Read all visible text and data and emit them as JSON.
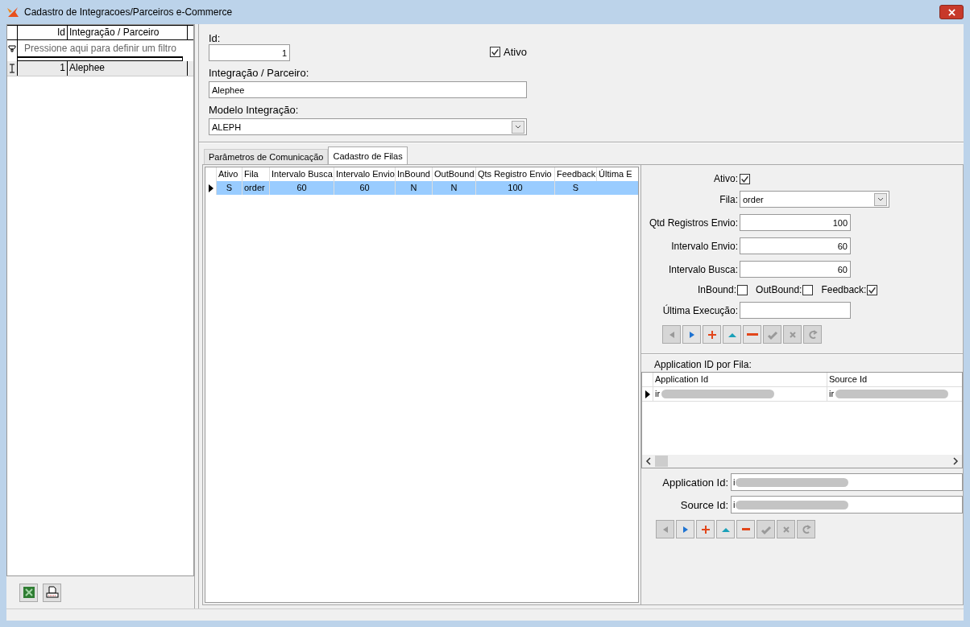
{
  "window": {
    "title": "Cadastro de Integracoes/Parceiros e-Commerce"
  },
  "left_grid": {
    "columns": [
      "Id",
      "Integração / Parceiro"
    ],
    "filter_hint": "Pressione aqui para definir um filtro",
    "rows": [
      {
        "id": "1",
        "name": "Alephee",
        "selected": true
      }
    ]
  },
  "left_toolbar": [
    {
      "kind": "excel"
    },
    {
      "kind": "print"
    }
  ],
  "form": {
    "id_label": "Id:",
    "id_value": "1",
    "ativo": {
      "label": "Ativo",
      "checked": true
    },
    "partner_label": "Integração / Parceiro:",
    "partner_value": "Alephee",
    "model_label": "Modelo Integração:",
    "model_value": "ALEPH"
  },
  "tabs": [
    {
      "label": "Parâmetros de Comunicação",
      "selected": false
    },
    {
      "label": "Cadastro de Filas",
      "selected": true
    }
  ],
  "queue_grid": {
    "columns": [
      "Ativo",
      "Fila",
      "Intervalo Busca",
      "Intervalo Envio",
      "InBound",
      "OutBound",
      "Qts Registro Envio",
      "Feedback",
      "Última E"
    ],
    "rows": [
      {
        "cells": [
          "S",
          "order",
          "60",
          "60",
          "N",
          "N",
          "100",
          "S"
        ],
        "selected": true
      }
    ]
  },
  "queue_form": {
    "ativo_label": "Ativo:",
    "ativo_checked": true,
    "fila_label": "Fila:",
    "fila_value": "order",
    "qtd_label": "Qtd Registros Envio:",
    "qtd_value": "100",
    "envio_label": "Intervalo Envio:",
    "envio_value": "60",
    "busca_label": "Intervalo Busca:",
    "busca_value": "60",
    "flags": [
      {
        "label": "InBound:",
        "checked": false
      },
      {
        "label": "OutBound:",
        "checked": false
      },
      {
        "label": "Feedback:",
        "checked": true
      }
    ],
    "ultima_label": "Última Execução:"
  },
  "queue_nav": [
    {
      "kind": "prior",
      "disabled": true
    },
    {
      "kind": "next",
      "disabled": false
    },
    {
      "kind": "insert",
      "disabled": false
    },
    {
      "kind": "edit",
      "disabled": false
    },
    {
      "kind": "delete",
      "disabled": false
    },
    {
      "kind": "post",
      "disabled": true
    },
    {
      "kind": "cancel",
      "disabled": true
    },
    {
      "kind": "refresh",
      "disabled": true
    }
  ],
  "app_ids": {
    "title": "Application ID por Fila:",
    "columns": [
      "Application Id",
      "Source Id"
    ],
    "rows": [
      {
        "cells": [
          "ir",
          "ir"
        ],
        "selected": true
      }
    ],
    "app_label": "Application Id:",
    "app_value": "i",
    "source_label": "Source Id:",
    "source_value": "i"
  },
  "app_nav": [
    {
      "kind": "prior",
      "disabled": true
    },
    {
      "kind": "next",
      "disabled": false
    },
    {
      "kind": "insert",
      "disabled": false
    },
    {
      "kind": "edit",
      "disabled": false
    },
    {
      "kind": "delete",
      "disabled": false
    },
    {
      "kind": "post",
      "disabled": true
    },
    {
      "kind": "cancel",
      "disabled": true
    },
    {
      "kind": "refresh",
      "disabled": true
    }
  ]
}
